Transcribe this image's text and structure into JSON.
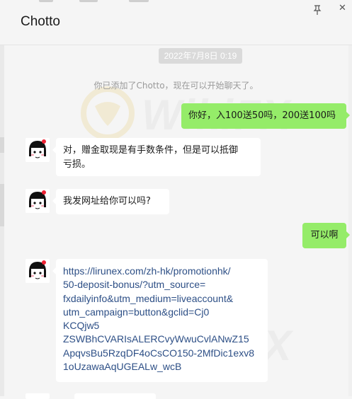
{
  "window": {
    "title": "Chotto"
  },
  "chat": {
    "timestamp": "2022年7月8日 0:19",
    "system_message": "你已添加了Chotto，现在可以开始聊天了。",
    "messages": [
      {
        "side": "out",
        "text": "你好，入100送50吗，200送100吗"
      },
      {
        "side": "in",
        "lines": [
          "对，赠金取现是有手数条件，但是可以抵御",
          "亏损。"
        ]
      },
      {
        "side": "in",
        "text": "我发网址给你可以吗?"
      },
      {
        "side": "out",
        "text": "可以啊"
      },
      {
        "side": "in",
        "link_lines": [
          "https://lirunex.com/zh-hk/promotionhk/",
          "50-deposit-bonus/?utm_source=",
          "fxdailyinfo&utm_medium=liveaccount&",
          "utm_campaign=button&gclid=Cj0",
          "KCQjw5",
          "ZSWBhCVARIsALERCvyWwuCvlANwZ15",
          "ApqvsBu5RzqDF4oCsCO150-2MfDic1exv8",
          "1oUzawaAqUGEALw_wcB"
        ]
      }
    ]
  },
  "watermark": {
    "text": "WikiFX"
  },
  "icons": {
    "pin": "pin-icon",
    "close": "close-icon",
    "avatar": "avatar-icon"
  },
  "colors": {
    "outgoing_bubble": "#95ec69",
    "incoming_bubble": "#ffffff",
    "background": "#f5f5f5"
  }
}
